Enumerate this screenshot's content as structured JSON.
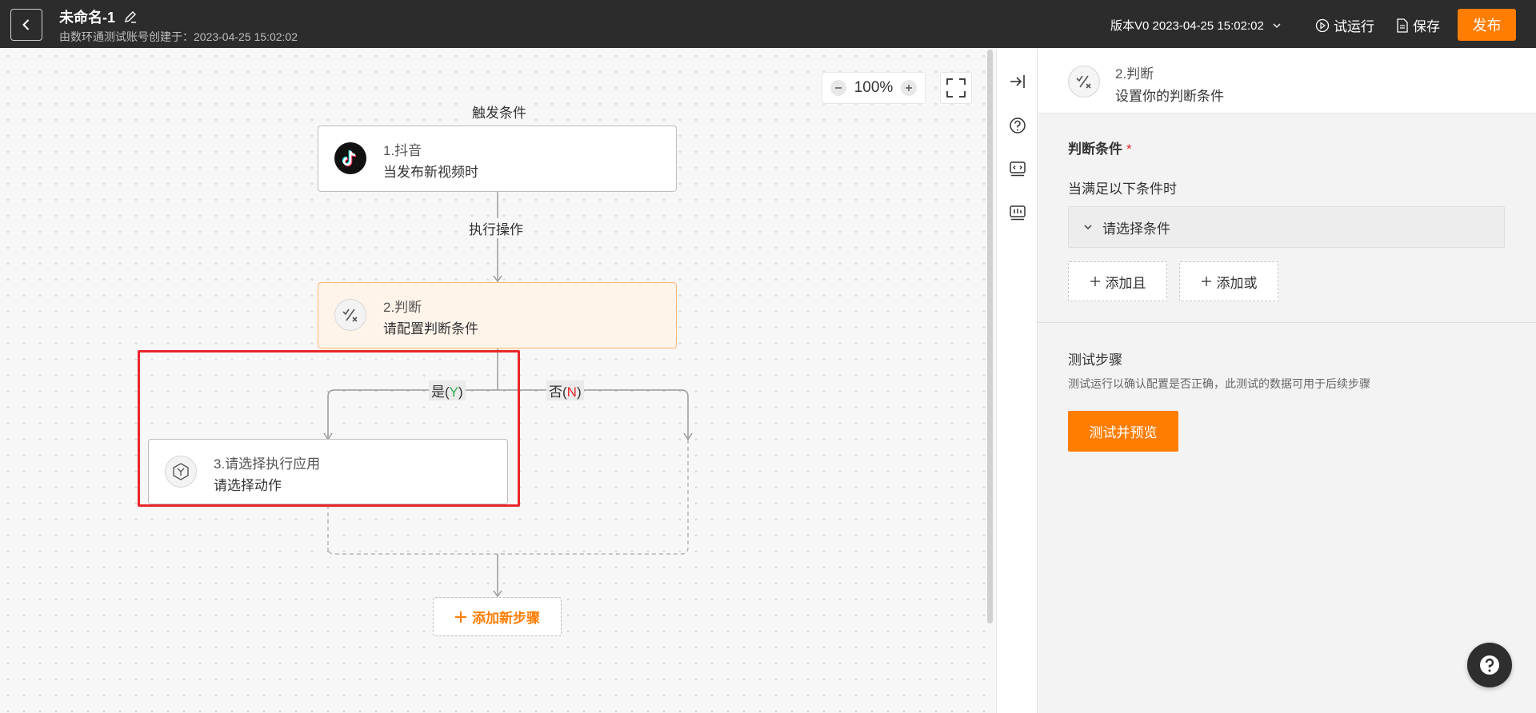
{
  "header": {
    "title": "未命名-1",
    "subtitle": "由数环通测试账号创建于：2023-04-25 15:02:02",
    "version_label": "版本V0 2023-04-25 15:02:02",
    "trial_run_label": "试运行",
    "save_label": "保存",
    "publish_label": "发布"
  },
  "canvas": {
    "zoom": "100%",
    "trigger_label": "触发条件",
    "action_label": "执行操作",
    "nodes": [
      {
        "title": "1.抖音",
        "subtitle": "当发布新视频时",
        "icon": "douyin-logo-icon"
      },
      {
        "title": "2.判断",
        "subtitle": "请配置判断条件",
        "icon": "condition-icon"
      },
      {
        "title": "3.请选择执行应用",
        "subtitle": "请选择动作",
        "icon": "app-cube-icon"
      }
    ],
    "branch_yes": {
      "prefix": "是(",
      "key": "Y",
      "suffix": ")",
      "color": "#2fa94f"
    },
    "branch_no": {
      "prefix": "否(",
      "key": "N",
      "suffix": ")",
      "color": "#e8262b"
    },
    "add_step_label": "添加新步骤"
  },
  "panel": {
    "step_title": "2.判断",
    "step_subtitle": "设置你的判断条件",
    "condition_section_title": "判断条件",
    "required_mark": "*",
    "condition_label": "当满足以下条件时",
    "condition_select_placeholder": "请选择条件",
    "add_and_label": "添加且",
    "add_or_label": "添加或",
    "test_title": "测试步骤",
    "test_desc": "测试运行以确认配置是否正确，此测试的数据可用于后续步骤",
    "test_button_label": "测试并预览"
  },
  "colors": {
    "accent": "#ff7d00",
    "header_bg": "#2c2c2c",
    "highlight": "#e8262b"
  }
}
